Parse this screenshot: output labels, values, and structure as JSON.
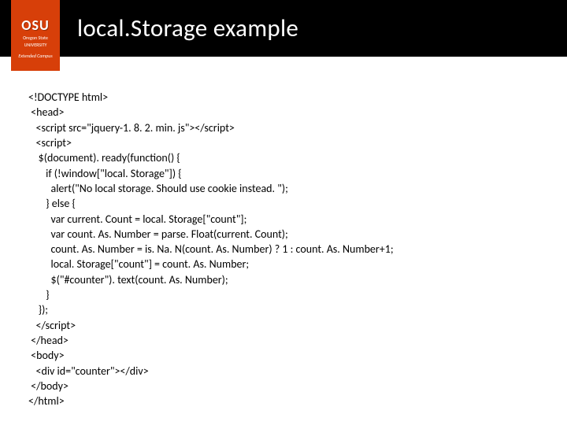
{
  "logo": {
    "main": "OSU",
    "sub1": "Oregon State",
    "sub2": "UNIVERSITY",
    "ext": "Extended Campus"
  },
  "title": "local.Storage example",
  "code": {
    "l0": "<!DOCTYPE html>",
    "l1": " <head>",
    "l2": "   <script src=\"jquery-1. 8. 2. min. js\"></script>",
    "l3": "   <script>",
    "l4": "    $(document). ready(function() {",
    "l5": "       if (!window[\"local. Storage\"]) {",
    "l6": "         alert(\"No local storage. Should use cookie instead. \");",
    "l7": "       } else {",
    "l8": "         var current. Count = local. Storage[\"count\"];",
    "l9": "         var count. As. Number = parse. Float(current. Count);",
    "l10": "         count. As. Number = is. Na. N(count. As. Number) ? 1 : count. As. Number+1;",
    "l11": "         local. Storage[\"count\"] = count. As. Number;",
    "l12": "         $(\"#counter\"). text(count. As. Number);",
    "l13": "       }",
    "l14": "    });",
    "l15": "   </script>",
    "l16": " </head>",
    "l17": " <body>",
    "l18": "   <div id=\"counter\"></div>",
    "l19": " </body>",
    "l20": "</html>"
  }
}
